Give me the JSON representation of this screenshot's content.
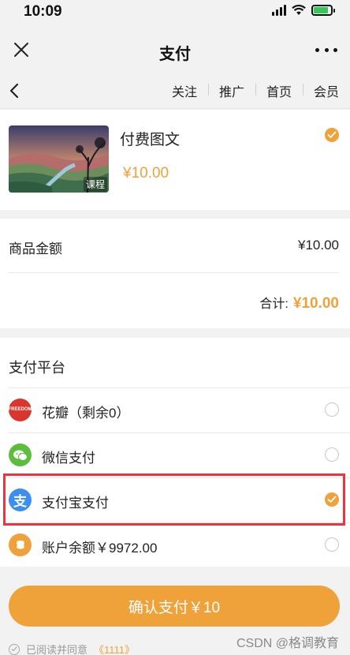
{
  "status_bar": {
    "time": "10:09"
  },
  "nav": {
    "title": "支付"
  },
  "sub_nav": {
    "links": [
      "关注",
      "推广",
      "首页",
      "会员"
    ]
  },
  "product": {
    "name": "付费图文",
    "price": "¥10.00",
    "thumb_tag": "课程"
  },
  "amount": {
    "label": "商品金额",
    "value": "¥10.00",
    "total_label": "合计:",
    "total_value": "¥10.00"
  },
  "payment": {
    "title": "支付平台",
    "options": [
      {
        "label": "花瓣（剩余0）",
        "icon": "huabei-icon",
        "icon_text": "FREEDOM",
        "color": "#d9362d",
        "selected": false
      },
      {
        "label": "微信支付",
        "icon": "wechat-icon",
        "color": "#5bbf3c",
        "selected": false
      },
      {
        "label": "支付宝支付",
        "icon": "alipay-icon",
        "icon_text": "支",
        "color": "#3b8ff2",
        "selected": true
      },
      {
        "label": "账户余额￥9972.00",
        "icon": "wallet-icon",
        "color": "#f0a23a",
        "selected": false
      }
    ]
  },
  "confirm": {
    "label": "确认支付￥10"
  },
  "agreement": {
    "text": "已阅读并同意",
    "link": "《1111》"
  },
  "watermark": "CSDN @格调教育",
  "colors": {
    "accent": "#f0a23a",
    "highlight": "#e8353f",
    "background": "#f2f2f2"
  }
}
